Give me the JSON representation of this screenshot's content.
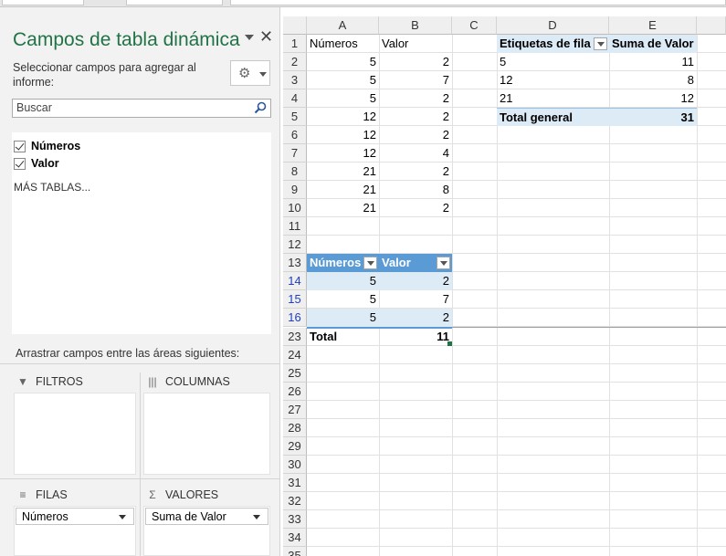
{
  "pane": {
    "title": "Campos de tabla dinámica",
    "close": "✕",
    "instruction": "Seleccionar campos para agregar al informe:",
    "search_placeholder": "Buscar",
    "fields": [
      {
        "label": "Números",
        "checked": true
      },
      {
        "label": "Valor",
        "checked": true
      }
    ],
    "more_tables": "MÁS TABLAS...",
    "drag_instruction": "Arrastrar campos entre las áreas siguientes:",
    "areas": {
      "filters": "FILTROS",
      "columns": "COLUMNAS",
      "rows": "FILAS",
      "values": "VALORES"
    },
    "rows_chip": "Números",
    "values_chip": "Suma de Valor"
  },
  "grid": {
    "columns": [
      "A",
      "B",
      "C",
      "D",
      "E"
    ],
    "row_numbers": [
      "1",
      "2",
      "3",
      "4",
      "5",
      "6",
      "7",
      "8",
      "9",
      "10",
      "11",
      "12",
      "13",
      "14",
      "15",
      "16",
      "23",
      "24",
      "25",
      "26",
      "27",
      "28",
      "29",
      "30",
      "31",
      "32",
      "33",
      "34",
      "35"
    ],
    "header_row": {
      "a": "Números",
      "b": "Valor"
    },
    "data": [
      {
        "a": "5",
        "b": "2"
      },
      {
        "a": "5",
        "b": "7"
      },
      {
        "a": "5",
        "b": "2"
      },
      {
        "a": "12",
        "b": "2"
      },
      {
        "a": "12",
        "b": "2"
      },
      {
        "a": "12",
        "b": "4"
      },
      {
        "a": "21",
        "b": "2"
      },
      {
        "a": "21",
        "b": "8"
      },
      {
        "a": "21",
        "b": "2"
      }
    ],
    "table": {
      "header_a": "Números",
      "header_b": "Valor",
      "rows": [
        {
          "a": "5",
          "b": "2"
        },
        {
          "a": "5",
          "b": "7"
        },
        {
          "a": "5",
          "b": "2"
        }
      ],
      "total_label": "Total",
      "total_value": "11"
    },
    "pivot": {
      "header_d": "Etiquetas de fila",
      "header_e": "Suma de Valor",
      "rows": [
        {
          "label": "5",
          "value": "11"
        },
        {
          "label": "12",
          "value": "8"
        },
        {
          "label": "21",
          "value": "12"
        }
      ],
      "total_label": "Total general",
      "total_value": "31"
    }
  },
  "colors": {
    "title_green": "#217346",
    "table_header_blue": "#5b9bd5",
    "pivot_band": "#ddebf7",
    "filtered_row_number": "#1f3fbf"
  }
}
